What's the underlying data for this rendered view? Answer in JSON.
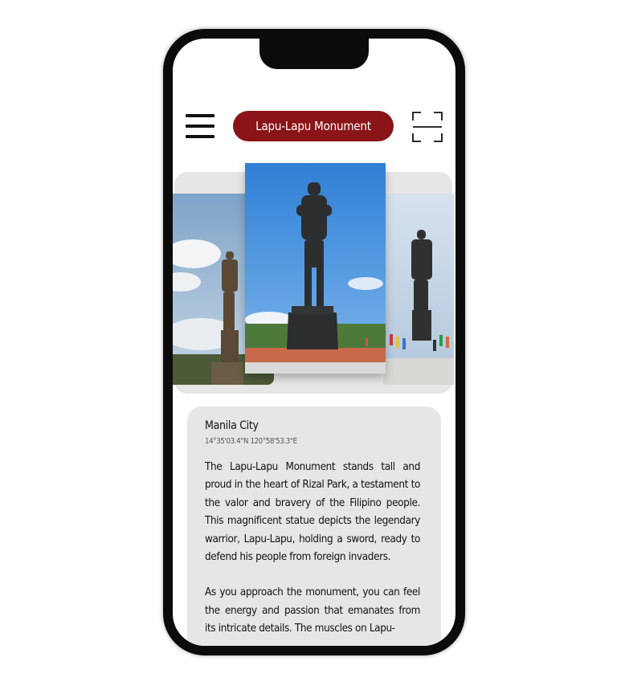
{
  "header": {
    "title": "Lapu-Lapu Monument",
    "menu_icon": "hamburger-menu-icon",
    "scan_icon": "scan-frame-icon"
  },
  "carousel": {
    "images": [
      {
        "name": "statue-photo-left"
      },
      {
        "name": "statue-photo-center"
      },
      {
        "name": "statue-photo-right"
      }
    ]
  },
  "location": {
    "city": "Manila City",
    "coordinates": "14°35'03.4\"N 120°58'53.3\"E"
  },
  "description": {
    "paragraph1": "The Lapu-Lapu Monument stands tall and proud in the heart of Rizal Park, a testament to the valor and bravery of the Filipino people. This magnificent statue depicts the legendary warrior, Lapu-Lapu, holding a sword, ready to defend his people from foreign invaders.",
    "paragraph2": "As you approach the monument, you can feel the energy and passion that emanates from its intricate details. The muscles on Lapu-"
  },
  "colors": {
    "accent": "#8a1418",
    "card_background": "#e6e6e6",
    "frame": "#0b0b0b"
  }
}
